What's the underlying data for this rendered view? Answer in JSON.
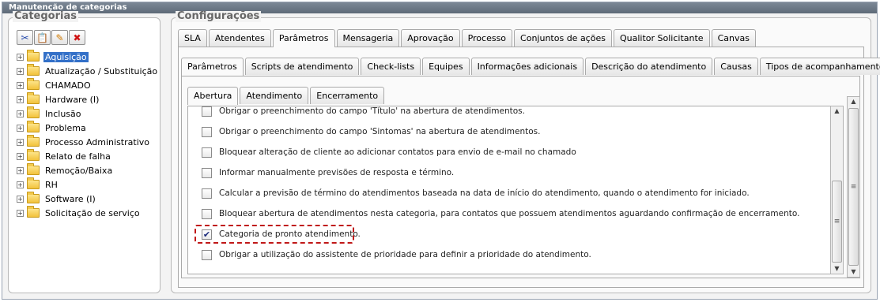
{
  "window": {
    "title": "Manutenção de categorias"
  },
  "left": {
    "legend": "Categorias",
    "toolbar": [
      {
        "name": "cut-button",
        "icon": "scissors-icon",
        "glyph": "✂",
        "color": "#2b4fb0"
      },
      {
        "name": "paste-button",
        "icon": "clipboard-icon",
        "glyph": "📋",
        "color": "#b07c1a"
      },
      {
        "name": "edit-button",
        "icon": "pencil-icon",
        "glyph": "✎",
        "color": "#d07a00"
      },
      {
        "name": "delete-button",
        "icon": "red-x-icon",
        "glyph": "✖",
        "color": "#d01515"
      }
    ],
    "tree": [
      {
        "label": "Aquisição",
        "selected": true
      },
      {
        "label": "Atualização / Substituição"
      },
      {
        "label": "CHAMADO"
      },
      {
        "label": "Hardware (I)"
      },
      {
        "label": "Inclusão"
      },
      {
        "label": "Problema"
      },
      {
        "label": "Processo Administrativo"
      },
      {
        "label": "Relato de falha"
      },
      {
        "label": "Remoção/Baixa"
      },
      {
        "label": "RH"
      },
      {
        "label": "Software (I)"
      },
      {
        "label": "Solicitação de serviço"
      }
    ]
  },
  "right": {
    "legend": "Configurações",
    "tabs1": [
      {
        "label": "SLA"
      },
      {
        "label": "Atendentes"
      },
      {
        "label": "Parâmetros",
        "active": true
      },
      {
        "label": "Mensageria"
      },
      {
        "label": "Aprovação"
      },
      {
        "label": "Processo"
      },
      {
        "label": "Conjuntos de ações"
      },
      {
        "label": "Qualitor Solicitante"
      },
      {
        "label": "Canvas"
      }
    ],
    "tabs2": [
      {
        "label": "Parâmetros",
        "active": true
      },
      {
        "label": "Scripts de atendimento"
      },
      {
        "label": "Check-lists"
      },
      {
        "label": "Equipes"
      },
      {
        "label": "Informações adicionais"
      },
      {
        "label": "Descrição do atendimento"
      },
      {
        "label": "Causas"
      },
      {
        "label": "Tipos de acompanhamento"
      }
    ],
    "tabs3": [
      {
        "label": "Abertura",
        "active": true
      },
      {
        "label": "Atendimento"
      },
      {
        "label": "Encerramento"
      }
    ],
    "options": [
      {
        "label": "Obrigar o preenchimento do campo 'Título' na abertura de atendimentos.",
        "checked": false
      },
      {
        "label": "Obrigar o preenchimento do campo 'Sintomas' na abertura de atendimentos.",
        "checked": false
      },
      {
        "label": "Bloquear alteração de cliente ao adicionar contatos para envio de e-mail no chamado",
        "checked": false
      },
      {
        "label": "Informar manualmente previsões de resposta e término.",
        "checked": false
      },
      {
        "label": "Calcular a previsão de término do atendimentos baseada na data de início do atendimento, quando o atendimento for iniciado.",
        "checked": false
      },
      {
        "label": "Bloquear abertura de atendimentos nesta categoria, para contatos que possuem atendimentos aguardando confirmação de encerramento.",
        "checked": false
      },
      {
        "label": "Categoria de pronto atendimento.",
        "checked": true,
        "highlighted": true
      },
      {
        "label": "Obrigar a utilização do assistente de prioridade para definir a prioridade do atendimento.",
        "checked": false
      }
    ],
    "highlight_color": "#c01818"
  }
}
